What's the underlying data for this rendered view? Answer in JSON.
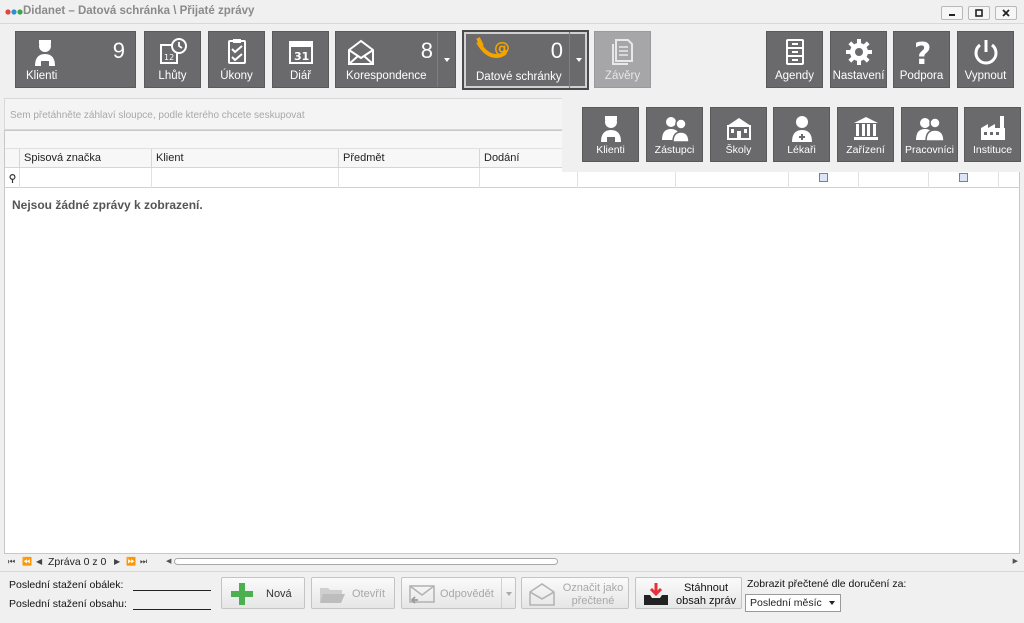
{
  "window": {
    "title": "Didanet – Datová schránka \\ Přijaté zprávy",
    "minimize_icon": "minimize-icon",
    "maximize_icon": "maximize-icon",
    "close_icon": "close-icon"
  },
  "toolbar": {
    "klienti": {
      "label": "Klienti",
      "count": "9",
      "icon": "client-icon"
    },
    "lhuty": {
      "label": "Lhůty",
      "icon": "calendar-clock-icon"
    },
    "ukony": {
      "label": "Úkony",
      "icon": "clipboard-check-icon"
    },
    "diar": {
      "label": "Diář",
      "icon": "calendar-31-icon",
      "day": "31"
    },
    "korespondence": {
      "label": "Korespondence",
      "count": "8",
      "icon": "envelope-icon"
    },
    "datove_schranky": {
      "label": "Datové schránky",
      "count": "0",
      "icon": "post-horn-at-icon"
    },
    "zavery": {
      "label": "Závěry",
      "icon": "document-stack-icon"
    },
    "agendy": {
      "label": "Agendy",
      "icon": "cabinet-icon"
    },
    "nastaveni": {
      "label": "Nastavení",
      "icon": "gear-icon"
    },
    "podpora": {
      "label": "Podpora",
      "icon": "question-icon"
    },
    "vypnout": {
      "label": "Vypnout",
      "icon": "power-icon"
    }
  },
  "agenda_menu": {
    "items": [
      {
        "label": "Klienti",
        "icon": "client-icon"
      },
      {
        "label": "Zástupci",
        "icon": "representatives-icon"
      },
      {
        "label": "Školy",
        "icon": "school-icon"
      },
      {
        "label": "Lékaři",
        "icon": "doctor-icon"
      },
      {
        "label": "Zařízení",
        "icon": "facility-icon"
      },
      {
        "label": "Pracovníci",
        "icon": "workers-icon"
      },
      {
        "label": "Instituce",
        "icon": "factory-icon"
      }
    ]
  },
  "grid": {
    "group_hint": "Sem přetáhněte záhlaví sloupce, podle kterého chcete seskupovat",
    "columns": [
      "Spisová značka",
      "Klient",
      "Předmět",
      "Dodání"
    ],
    "empty_message": "Nejsou žádné zprávy k zobrazení.",
    "filter_icon": "filter-pin-icon"
  },
  "navigator": {
    "text": "Zpráva 0 z 0",
    "first": "⏮",
    "prev_page": "⏪",
    "prev": "◀",
    "next": "▶",
    "next_page": "⏩",
    "last": "⏭"
  },
  "bottom": {
    "last_envelope_label": "Poslední stažení obálek:",
    "last_content_label": "Poslední stažení obsahu:",
    "new_button": "Nová",
    "open_button": "Otevřít",
    "reply_button": "Odpovědět",
    "mark_read_line1": "Označit jako",
    "mark_read_line2": "přečtené",
    "download_line1": "Stáhnout",
    "download_line2": "obsah zpráv",
    "period_label": "Zobrazit přečtené dle doručení za:",
    "period_value": "Poslední měsíc"
  },
  "colors": {
    "tile": "#6a6a6c",
    "tile_disabled": "#a6a6a8",
    "horn": "#f2a400",
    "plus": "#4caf50",
    "download_red": "#e8303a"
  }
}
